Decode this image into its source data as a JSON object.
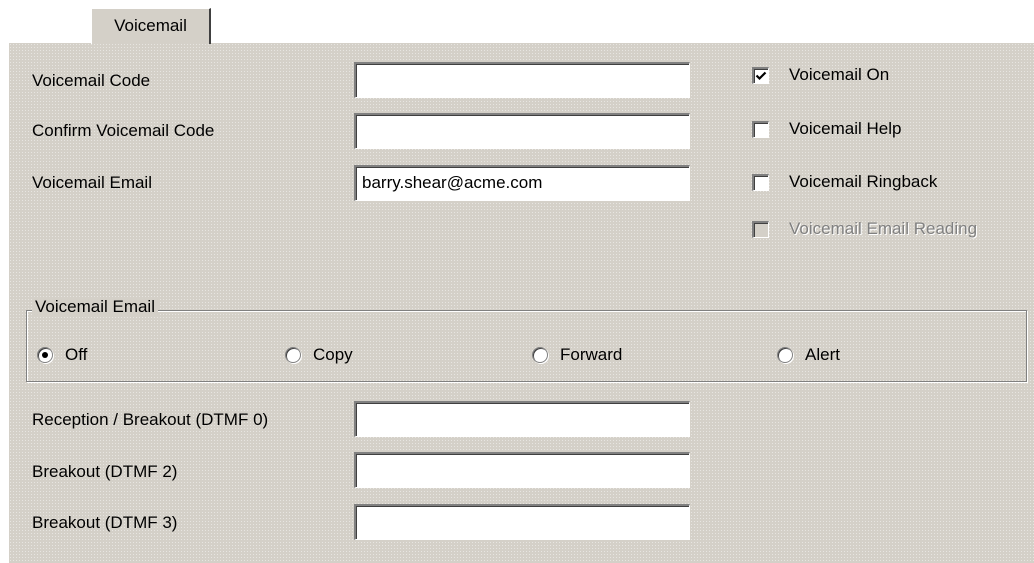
{
  "tab": {
    "label": "Voicemail"
  },
  "fields": {
    "voicemail_code": {
      "label": "Voicemail Code",
      "value": ""
    },
    "confirm_code": {
      "label": "Confirm Voicemail Code",
      "value": ""
    },
    "voicemail_email": {
      "label": "Voicemail Email",
      "value": "barry.shear@acme.com"
    },
    "reception_breakout": {
      "label": "Reception / Breakout (DTMF 0)",
      "value": ""
    },
    "breakout_2": {
      "label": "Breakout (DTMF 2)",
      "value": ""
    },
    "breakout_3": {
      "label": "Breakout (DTMF 3)",
      "value": ""
    }
  },
  "checkboxes": {
    "voicemail_on": {
      "label": "Voicemail On",
      "checked": true,
      "enabled": true
    },
    "voicemail_help": {
      "label": "Voicemail Help",
      "checked": false,
      "enabled": true
    },
    "voicemail_ringback": {
      "label": "Voicemail Ringback",
      "checked": false,
      "enabled": true
    },
    "voicemail_email_reading": {
      "label": "Voicemail Email Reading",
      "checked": false,
      "enabled": false
    }
  },
  "email_group": {
    "title": "Voicemail Email",
    "selected": "Off",
    "options": {
      "off": "Off",
      "copy": "Copy",
      "forward": "Forward",
      "alert": "Alert"
    }
  },
  "colors": {
    "panel_background": "#d4d0c8",
    "disabled_text": "#808080"
  }
}
